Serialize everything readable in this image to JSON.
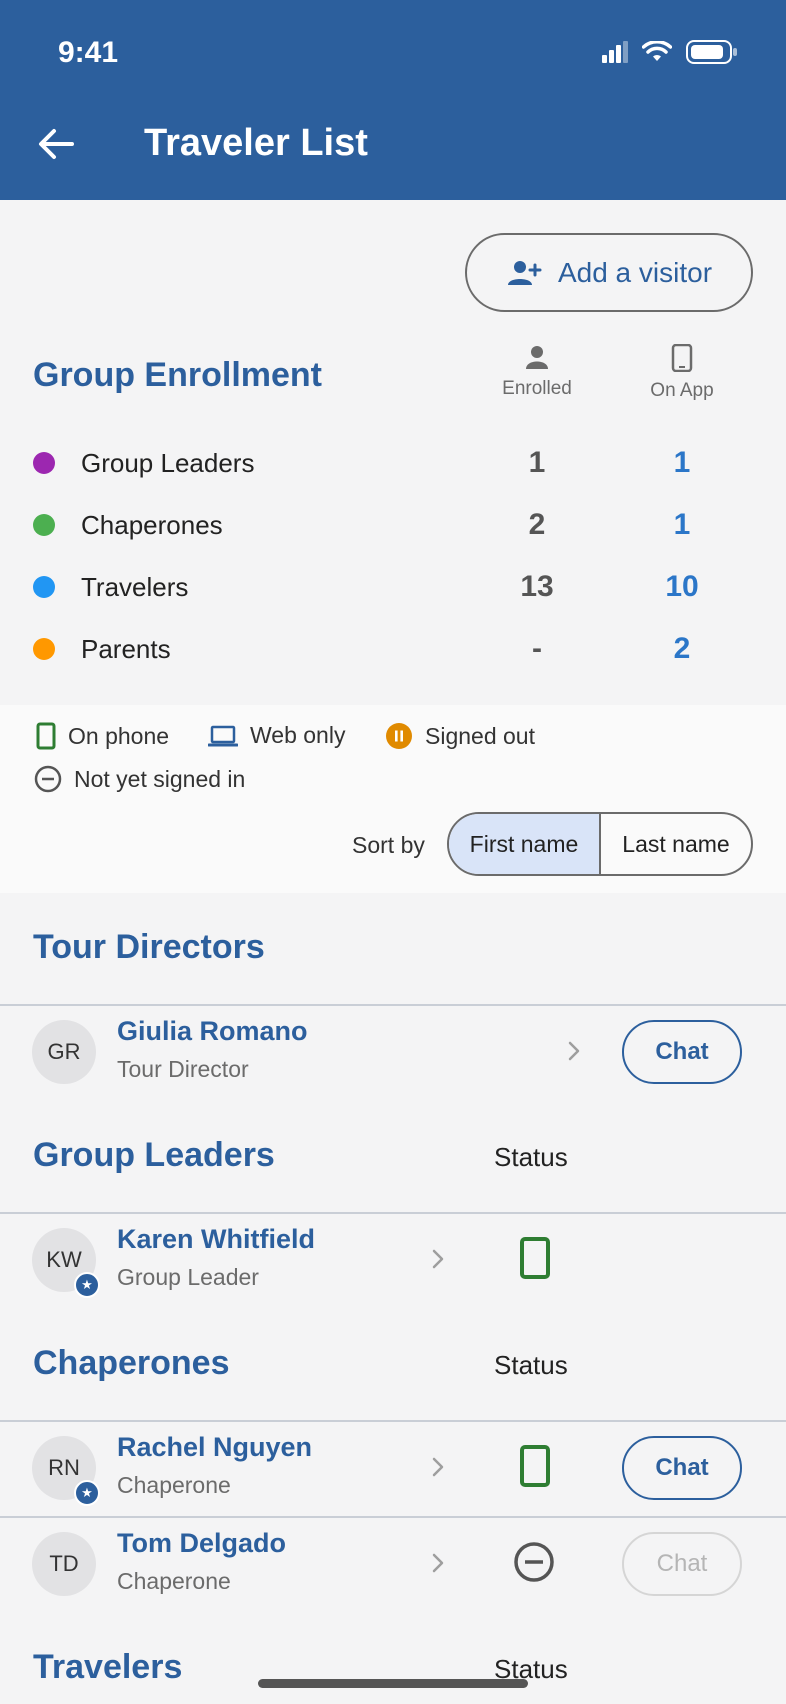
{
  "status_bar": {
    "time": "9:41"
  },
  "header": {
    "title": "Traveler List"
  },
  "add_visitor": {
    "label": "Add a visitor"
  },
  "enrollment": {
    "title": "Group Enrollment",
    "col_enrolled": "Enrolled",
    "col_on_app": "On App",
    "rows": [
      {
        "label": "Group Leaders",
        "enrolled": "1",
        "on_app": "1",
        "color": "#9c27b0"
      },
      {
        "label": "Chaperones",
        "enrolled": "2",
        "on_app": "1",
        "color": "#4caf50"
      },
      {
        "label": "Travelers",
        "enrolled": "13",
        "on_app": "10",
        "color": "#2196f3"
      },
      {
        "label": "Parents",
        "enrolled": "-",
        "on_app": "2",
        "color": "#ff9800"
      }
    ]
  },
  "legend": {
    "on_phone": "On phone",
    "web_only": "Web only",
    "signed_out": "Signed out",
    "not_signed_in": "Not yet signed in"
  },
  "sort": {
    "label": "Sort by",
    "first_name": "First name",
    "last_name": "Last name",
    "selected": "First name"
  },
  "sections": {
    "tour_directors": {
      "title": "Tour Directors",
      "people": [
        {
          "initials": "GR",
          "name": "Giulia Romano",
          "role": "Tour Director",
          "chat": "Chat"
        }
      ]
    },
    "group_leaders": {
      "title": "Group Leaders",
      "status_label": "Status",
      "people": [
        {
          "initials": "KW",
          "name": "Karen Whitfield",
          "role": "Group Leader",
          "status": "on-phone"
        }
      ]
    },
    "chaperones": {
      "title": "Chaperones",
      "status_label": "Status",
      "people": [
        {
          "initials": "RN",
          "name": "Rachel Nguyen",
          "role": "Chaperone",
          "status": "on-phone",
          "chat": "Chat"
        },
        {
          "initials": "TD",
          "name": "Tom Delgado",
          "role": "Chaperone",
          "status": "not-yet-signed-in",
          "chat": "Chat"
        }
      ]
    },
    "travelers": {
      "title": "Travelers",
      "status_label": "Status"
    }
  },
  "colors": {
    "brand": "#2c5f9d",
    "on_app": "#2b76c8",
    "phone_green": "#2e7d32",
    "signed_out": "#e08a00"
  }
}
